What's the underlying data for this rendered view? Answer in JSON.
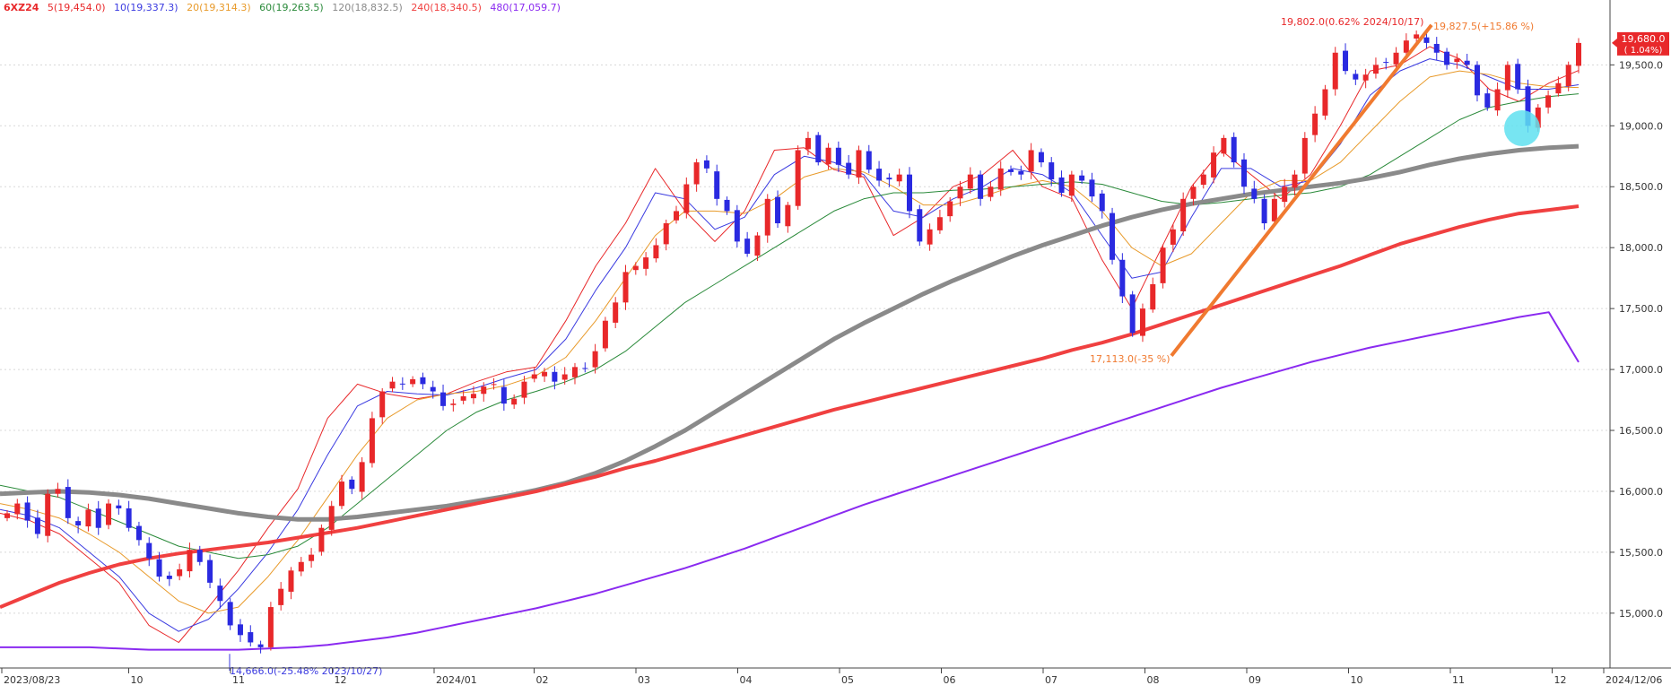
{
  "chart_data": {
    "type": "candlestick",
    "symbol": "6XZ24",
    "start_date_label": "2023/08/23",
    "end_date_label": "2024/12/06",
    "x_ticks": [
      "2023/08/23",
      "10",
      "11",
      "12",
      "2024/01",
      "02",
      "03",
      "04",
      "05",
      "06",
      "07",
      "08",
      "09",
      "10",
      "11",
      "12",
      "2024/12/06"
    ],
    "y_ticks": [
      "15,000.0",
      "15,500.0",
      "16,000.0",
      "16,500.0",
      "17,000.0",
      "17,500.0",
      "18,000.0",
      "18,500.0",
      "19,000.0",
      "19,500.0"
    ],
    "ylim": [
      14550,
      19900
    ],
    "last_price": "19,680.0",
    "last_change": "( 1.04%)",
    "legend": [
      {
        "label": "5(19,454.0)",
        "color": "#e8282a"
      },
      {
        "label": "10(19,337.3)",
        "color": "#3a3ae0"
      },
      {
        "label": "20(19,314.3)",
        "color": "#e89a2a"
      },
      {
        "label": "60(19,263.5)",
        "color": "#2a8a3a"
      },
      {
        "label": "120(18,832.5)",
        "color": "#8a8a8a"
      },
      {
        "label": "240(18,340.5)",
        "color": "#f04040"
      },
      {
        "label": "480(17,059.7)",
        "color": "#8a2af0"
      }
    ],
    "close_series": [
      15820,
      15900,
      15760,
      15650,
      15980,
      16020,
      15780,
      15720,
      15850,
      15700,
      15900,
      15860,
      15700,
      15600,
      15450,
      15300,
      15280,
      15360,
      15520,
      15420,
      15250,
      15100,
      14900,
      14820,
      14760,
      14720,
      15050,
      15200,
      15350,
      15420,
      15480,
      15700,
      15880,
      16080,
      16020,
      16240,
      16600,
      16820,
      16900,
      16880,
      16920,
      16880,
      16820,
      16700,
      16720,
      16780,
      16800,
      16860,
      16880,
      16720,
      16760,
      16900,
      16960,
      16980,
      16900,
      16960,
      17020,
      17010,
      17150,
      17400,
      17550,
      17800,
      17850,
      17920,
      18020,
      18200,
      18300,
      18520,
      18700,
      18650,
      18400,
      18300,
      18050,
      17950,
      18100,
      18400,
      18200,
      18350,
      18800,
      18900,
      18700,
      18820,
      18680,
      18600,
      18800,
      18640,
      18550,
      18560,
      18600,
      18300,
      18050,
      18150,
      18250,
      18380,
      18500,
      18600,
      18400,
      18500,
      18650,
      18620,
      18600,
      18800,
      18700,
      18560,
      18450,
      18600,
      18550,
      18420,
      18300,
      17900,
      17600,
      17300,
      17500,
      17700,
      18000,
      18150,
      18400,
      18500,
      18600,
      18780,
      18900,
      18700,
      18500,
      18400,
      18200,
      18400,
      18500,
      18600,
      18900,
      19100,
      19300,
      19600,
      19450,
      19380,
      19420,
      19500,
      19520,
      19600,
      19700,
      19750,
      19680,
      19600,
      19500,
      19550,
      19500,
      19250,
      19150,
      19300,
      19500,
      19300,
      19000,
      19150,
      19250,
      19350,
      19500,
      19680
    ],
    "ma_series": [
      {
        "name": "5",
        "values": [
          15820,
          15760,
          15650,
          15450,
          15250,
          14900,
          14760,
          15050,
          15350,
          15700,
          16020,
          16600,
          16880,
          16800,
          16760,
          16800,
          16900,
          16980,
          17020,
          17400,
          17850,
          18200,
          18650,
          18300,
          18050,
          18300,
          18800,
          18820,
          18640,
          18580,
          18100,
          18250,
          18500,
          18600,
          18800,
          18500,
          18400,
          17900,
          17500,
          18000,
          18500,
          18800,
          18600,
          18400,
          18600,
          19000,
          19450,
          19500,
          19650,
          19550,
          19300,
          19200,
          19350,
          19454
        ]
      },
      {
        "name": "10",
        "values": [
          15850,
          15800,
          15700,
          15500,
          15300,
          15000,
          14850,
          14950,
          15200,
          15500,
          15850,
          16300,
          16700,
          16820,
          16800,
          16790,
          16850,
          16930,
          17000,
          17250,
          17650,
          18000,
          18450,
          18400,
          18150,
          18250,
          18600,
          18750,
          18700,
          18600,
          18300,
          18250,
          18400,
          18500,
          18650,
          18600,
          18450,
          18100,
          17750,
          17800,
          18250,
          18650,
          18650,
          18500,
          18550,
          18850,
          19250,
          19450,
          19550,
          19500,
          19400,
          19300,
          19300,
          19337
        ]
      },
      {
        "name": "20",
        "values": [
          15900,
          15850,
          15780,
          15650,
          15500,
          15300,
          15100,
          15000,
          15050,
          15300,
          15600,
          15950,
          16300,
          16600,
          16750,
          16800,
          16820,
          16870,
          16950,
          17100,
          17400,
          17750,
          18100,
          18300,
          18300,
          18280,
          18400,
          18580,
          18650,
          18620,
          18500,
          18350,
          18350,
          18420,
          18500,
          18550,
          18500,
          18300,
          18000,
          17850,
          17950,
          18200,
          18450,
          18550,
          18550,
          18700,
          18950,
          19200,
          19400,
          19450,
          19420,
          19350,
          19320,
          19314
        ]
      },
      {
        "name": "60",
        "values": [
          16050,
          16000,
          15950,
          15850,
          15750,
          15650,
          15550,
          15500,
          15450,
          15480,
          15550,
          15700,
          15900,
          16100,
          16300,
          16500,
          16650,
          16750,
          16820,
          16900,
          17000,
          17150,
          17350,
          17550,
          17700,
          17850,
          18000,
          18150,
          18300,
          18400,
          18450,
          18450,
          18470,
          18480,
          18500,
          18520,
          18540,
          18520,
          18450,
          18380,
          18350,
          18370,
          18400,
          18430,
          18450,
          18500,
          18600,
          18750,
          18900,
          19050,
          19150,
          19200,
          19240,
          19263
        ]
      },
      {
        "name": "120",
        "values": [
          15980,
          15990,
          16000,
          15990,
          15970,
          15940,
          15900,
          15860,
          15820,
          15790,
          15770,
          15770,
          15790,
          15820,
          15850,
          15880,
          15920,
          15960,
          16010,
          16070,
          16150,
          16250,
          16370,
          16500,
          16650,
          16800,
          16950,
          17100,
          17250,
          17380,
          17500,
          17620,
          17730,
          17830,
          17930,
          18020,
          18100,
          18180,
          18250,
          18310,
          18360,
          18400,
          18440,
          18470,
          18500,
          18530,
          18570,
          18620,
          18680,
          18730,
          18770,
          18800,
          18820,
          18832
        ]
      },
      {
        "name": "240",
        "values": [
          15050,
          15150,
          15250,
          15330,
          15400,
          15450,
          15490,
          15520,
          15550,
          15580,
          15620,
          15660,
          15700,
          15750,
          15800,
          15850,
          15900,
          15950,
          16000,
          16060,
          16120,
          16190,
          16250,
          16320,
          16390,
          16460,
          16530,
          16600,
          16670,
          16730,
          16790,
          16850,
          16910,
          16970,
          17030,
          17090,
          17160,
          17220,
          17290,
          17370,
          17450,
          17530,
          17610,
          17690,
          17770,
          17850,
          17940,
          18030,
          18100,
          18170,
          18230,
          18280,
          18310,
          18340
        ]
      },
      {
        "name": "480",
        "values": [
          14720,
          14720,
          14720,
          14720,
          14710,
          14700,
          14700,
          14700,
          14700,
          14710,
          14720,
          14740,
          14770,
          14800,
          14840,
          14890,
          14940,
          14990,
          15040,
          15100,
          15160,
          15230,
          15300,
          15370,
          15450,
          15530,
          15620,
          15710,
          15800,
          15890,
          15970,
          16050,
          16130,
          16210,
          16290,
          16370,
          16450,
          16530,
          16610,
          16690,
          16770,
          16850,
          16920,
          16990,
          17060,
          17120,
          17180,
          17230,
          17280,
          17330,
          17380,
          17430,
          17470,
          17060
        ]
      }
    ],
    "annotations": [
      {
        "text": "19,802.0(0.62% 2024/10/17)",
        "color": "#e8282a"
      },
      {
        "text": "19,827.5(+15.86 %)",
        "color": "#f07a30"
      },
      {
        "text": "17,113.0(-35 %)",
        "color": "#f07a30"
      },
      {
        "text": "14,666.0(-25.48% 2023/10/27)",
        "color": "#3a3ae0"
      }
    ],
    "colors": {
      "up": "#e8282a",
      "down": "#2a2ae0",
      "trendline": "#f07a30",
      "highlight": "#5fe0f0"
    }
  }
}
